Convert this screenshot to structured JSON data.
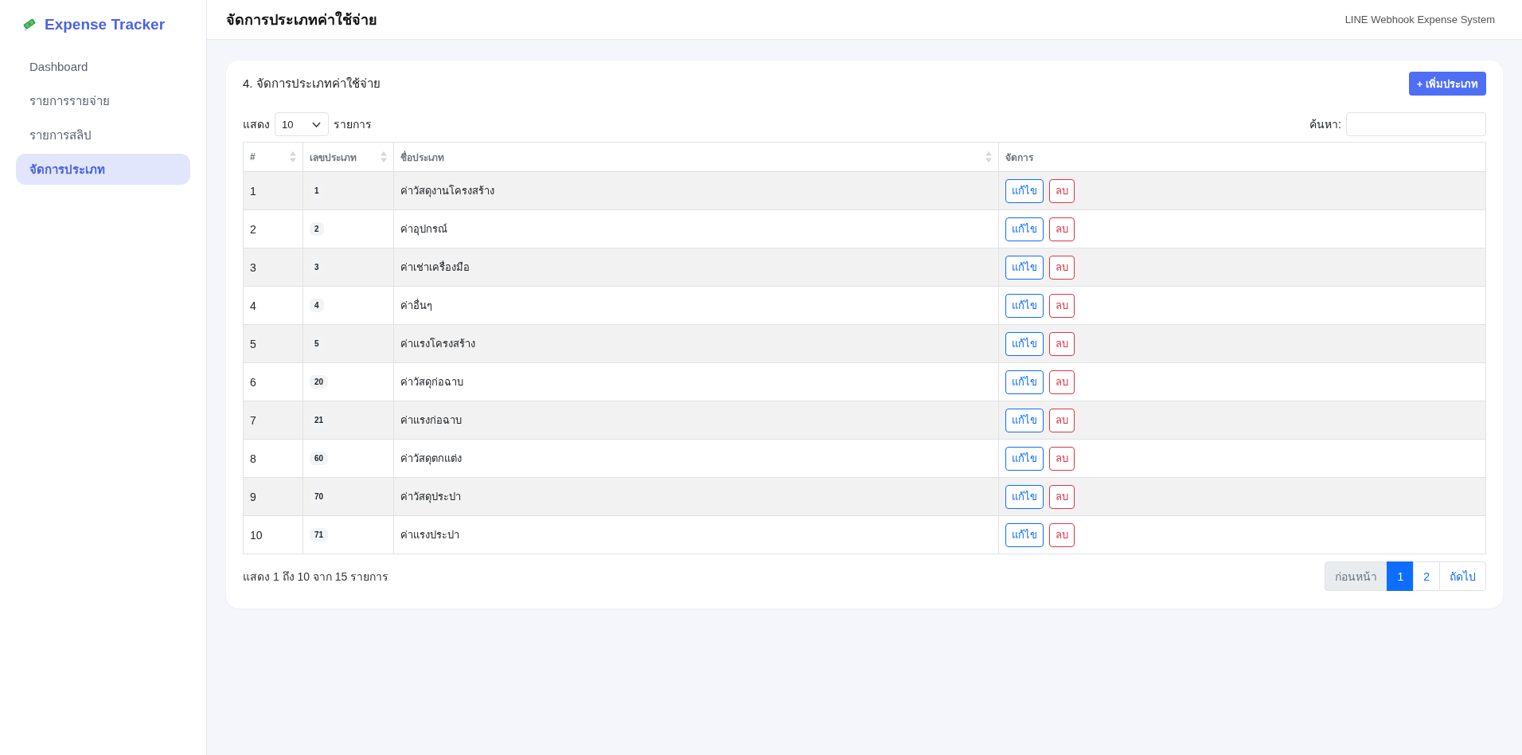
{
  "sidebar": {
    "brand": "Expense Tracker",
    "items": [
      {
        "label": "Dashboard",
        "selected": false
      },
      {
        "label": "รายการรายจ่าย",
        "selected": false
      },
      {
        "label": "รายการสลิป",
        "selected": false
      },
      {
        "label": "จัดการประเภท",
        "selected": true
      }
    ]
  },
  "header": {
    "title": "จัดการประเภทค่าใช้จ่าย",
    "subtitle": "LINE Webhook Expense System"
  },
  "card": {
    "title": "4. จัดการประเภทค่าใช้จ่าย",
    "add_button": "+ เพิ่มประเภท",
    "length_menu": {
      "prefix": "แสดง",
      "value": "10",
      "suffix": "รายการ"
    },
    "search": {
      "label": "ค้นหา:"
    },
    "table": {
      "columns": [
        {
          "label": "#",
          "sortable": true
        },
        {
          "label": "เลขประเภท",
          "sortable": true
        },
        {
          "label": "ชื่อประเภท",
          "sortable": true
        },
        {
          "label": "จัดการ",
          "sortable": false
        }
      ],
      "rows": [
        {
          "index": "1",
          "code": "1",
          "name": "ค่าวัสดุงานโครงสร้าง",
          "edit": "แก้ไข",
          "delete": "ลบ"
        },
        {
          "index": "2",
          "code": "2",
          "name": "ค่าอุปกรณ์",
          "edit": "แก้ไข",
          "delete": "ลบ"
        },
        {
          "index": "3",
          "code": "3",
          "name": "ค่าเช่าเครื่องมือ",
          "edit": "แก้ไข",
          "delete": "ลบ"
        },
        {
          "index": "4",
          "code": "4",
          "name": "ค่าอื่นๆ",
          "edit": "แก้ไข",
          "delete": "ลบ"
        },
        {
          "index": "5",
          "code": "5",
          "name": "ค่าแรงโครงสร้าง",
          "edit": "แก้ไข",
          "delete": "ลบ"
        },
        {
          "index": "6",
          "code": "20",
          "name": "ค่าวัสดุก่อฉาบ",
          "edit": "แก้ไข",
          "delete": "ลบ"
        },
        {
          "index": "7",
          "code": "21",
          "name": "ค่าแรงก่อฉาบ",
          "edit": "แก้ไข",
          "delete": "ลบ"
        },
        {
          "index": "8",
          "code": "60",
          "name": "ค่าวัสดุตกแต่ง",
          "edit": "แก้ไข",
          "delete": "ลบ"
        },
        {
          "index": "9",
          "code": "70",
          "name": "ค่าวัสดุประปา",
          "edit": "แก้ไข",
          "delete": "ลบ"
        },
        {
          "index": "10",
          "code": "71",
          "name": "ค่าแรงประปา",
          "edit": "แก้ไข",
          "delete": "ลบ"
        }
      ]
    },
    "info": "แสดง 1 ถึง 10 จาก 15 รายการ",
    "pagination": [
      {
        "label": "ก่อนหน้า",
        "disabled": true,
        "selected": false
      },
      {
        "label": "1",
        "disabled": false,
        "selected": true
      },
      {
        "label": "2",
        "disabled": false,
        "selected": false
      },
      {
        "label": "ถัดไป",
        "disabled": false,
        "selected": false
      }
    ]
  }
}
